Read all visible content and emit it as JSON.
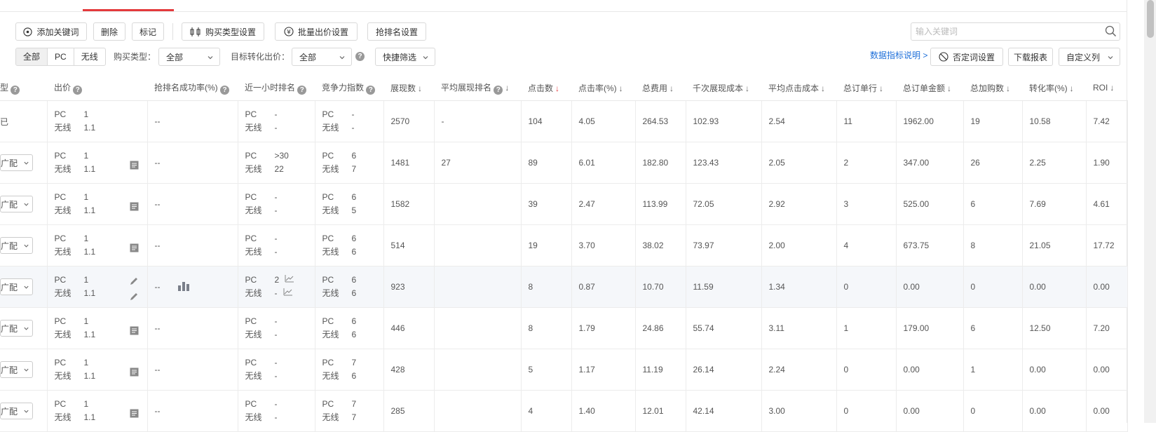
{
  "toolbar": {
    "add_keyword": "添加关键词",
    "delete": "删除",
    "mark": "标记",
    "purchase_type_settings": "购买类型设置",
    "batch_bid_settings": "批量出价设置",
    "grab_rank_settings": "抢排名设置"
  },
  "search": {
    "placeholder": "输入关键词"
  },
  "filters": {
    "device_tabs": [
      "全部",
      "PC",
      "无线"
    ],
    "purchase_type_label": "购买类型：",
    "purchase_type_value": "全部",
    "target_bid_label": "目标转化出价：",
    "target_bid_value": "全部",
    "quick_filter": "快捷筛选"
  },
  "actions": {
    "metrics_help": "数据指标说明 >",
    "negative_words": "否定词设置",
    "download_report": "下载报表",
    "custom_columns": "自定义列"
  },
  "table": {
    "headers": {
      "type": "型",
      "bid": "出价",
      "grab_success": "抢排名成功率(%)",
      "hour_rank": "近一小时排名",
      "competition": "竞争力指数",
      "impressions": "展现数",
      "avg_rank": "平均展现排名",
      "clicks": "点击数",
      "ctr": "点击率(%)",
      "cost": "总费用",
      "cpm": "千次展现成本",
      "cpc": "平均点击成本",
      "orders": "总订单行",
      "order_amount": "总订单金额",
      "add_cart": "总加购数",
      "cvr": "转化率(%)",
      "roi": "ROI"
    },
    "pc_label": "PC",
    "mobile_label": "无线",
    "rows": [
      {
        "match": "已",
        "bid_pc": "1",
        "bid_m": "1.1",
        "grab": "--",
        "rank_pc": "-",
        "rank_m": "-",
        "comp_pc": "-",
        "comp_m": "-",
        "impressions": "2570",
        "avg_rank": "-",
        "clicks": "104",
        "ctr": "4.05",
        "cost": "264.53",
        "cpm": "102.93",
        "cpc": "2.54",
        "orders": "11",
        "amount": "1962.00",
        "cart": "19",
        "cvr": "10.58",
        "roi": "7.42"
      },
      {
        "match": "广配",
        "bid_pc": "1",
        "bid_m": "1.1",
        "grab": "--",
        "rank_pc": ">30",
        "rank_m": "22",
        "comp_pc": "6",
        "comp_m": "7",
        "impressions": "1481",
        "avg_rank": "27",
        "clicks": "89",
        "ctr": "6.01",
        "cost": "182.80",
        "cpm": "123.43",
        "cpc": "2.05",
        "orders": "2",
        "amount": "347.00",
        "cart": "26",
        "cvr": "2.25",
        "roi": "1.90"
      },
      {
        "match": "广配",
        "bid_pc": "1",
        "bid_m": "1.1",
        "grab": "--",
        "rank_pc": "-",
        "rank_m": "-",
        "comp_pc": "6",
        "comp_m": "5",
        "impressions": "1582",
        "avg_rank": "",
        "clicks": "39",
        "ctr": "2.47",
        "cost": "113.99",
        "cpm": "72.05",
        "cpc": "2.92",
        "orders": "3",
        "amount": "525.00",
        "cart": "6",
        "cvr": "7.69",
        "roi": "4.61"
      },
      {
        "match": "广配",
        "bid_pc": "1",
        "bid_m": "1.1",
        "grab": "--",
        "rank_pc": "-",
        "rank_m": "-",
        "comp_pc": "6",
        "comp_m": "6",
        "impressions": "514",
        "avg_rank": "",
        "clicks": "19",
        "ctr": "3.70",
        "cost": "38.02",
        "cpm": "73.97",
        "cpc": "2.00",
        "orders": "4",
        "amount": "673.75",
        "cart": "8",
        "cvr": "21.05",
        "roi": "17.72"
      },
      {
        "match": "广配",
        "bid_pc": "1",
        "bid_m": "1.1",
        "grab": "--",
        "rank_pc": "2",
        "rank_m": "-",
        "comp_pc": "6",
        "comp_m": "6",
        "impressions": "923",
        "avg_rank": "",
        "clicks": "8",
        "ctr": "0.87",
        "cost": "10.70",
        "cpm": "11.59",
        "cpc": "1.34",
        "orders": "0",
        "amount": "0.00",
        "cart": "0",
        "cvr": "0.00",
        "roi": "0.00"
      },
      {
        "match": "广配",
        "bid_pc": "1",
        "bid_m": "1.1",
        "grab": "--",
        "rank_pc": "-",
        "rank_m": "-",
        "comp_pc": "6",
        "comp_m": "6",
        "impressions": "446",
        "avg_rank": "",
        "clicks": "8",
        "ctr": "1.79",
        "cost": "24.86",
        "cpm": "55.74",
        "cpc": "3.11",
        "orders": "1",
        "amount": "179.00",
        "cart": "6",
        "cvr": "12.50",
        "roi": "7.20"
      },
      {
        "match": "广配",
        "bid_pc": "1",
        "bid_m": "1.1",
        "grab": "--",
        "rank_pc": "-",
        "rank_m": "-",
        "comp_pc": "7",
        "comp_m": "6",
        "impressions": "428",
        "avg_rank": "",
        "clicks": "5",
        "ctr": "1.17",
        "cost": "11.19",
        "cpm": "26.14",
        "cpc": "2.24",
        "orders": "0",
        "amount": "0.00",
        "cart": "1",
        "cvr": "0.00",
        "roi": "0.00"
      },
      {
        "match": "广配",
        "bid_pc": "1",
        "bid_m": "1.1",
        "grab": "--",
        "rank_pc": "-",
        "rank_m": "-",
        "comp_pc": "7",
        "comp_m": "7",
        "impressions": "285",
        "avg_rank": "",
        "clicks": "4",
        "ctr": "1.40",
        "cost": "12.01",
        "cpm": "42.14",
        "cpc": "3.00",
        "orders": "0",
        "amount": "0.00",
        "cart": "0",
        "cvr": "0.00",
        "roi": "0.00"
      }
    ]
  }
}
